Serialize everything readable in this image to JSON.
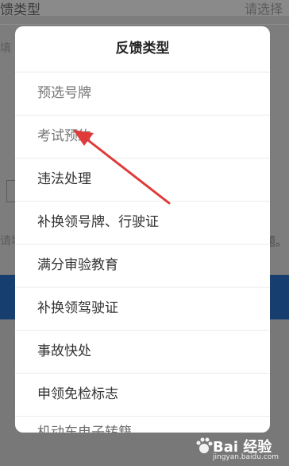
{
  "background": {
    "top_left_label": "馈类型",
    "top_right_placeholder": "请选择",
    "fill_hint_1": "填",
    "fill_hint_2": "请填",
    "trailing_text": "题。"
  },
  "dialog": {
    "title": "反馈类型",
    "options": [
      {
        "label": "预选号牌"
      },
      {
        "label": "考试预约"
      },
      {
        "label": "违法处理"
      },
      {
        "label": "补换领号牌、行驶证"
      },
      {
        "label": "满分审验教育"
      },
      {
        "label": "补换领驾驶证"
      },
      {
        "label": "事故快处"
      },
      {
        "label": "申领免检标志"
      },
      {
        "label": "机动车电子转籍"
      }
    ]
  },
  "annotation": {
    "icon": "red-arrow-icon",
    "color": "#e03a3a"
  },
  "watermark": {
    "text": "Bai 经验",
    "site": "jingyan.baidu.com"
  }
}
